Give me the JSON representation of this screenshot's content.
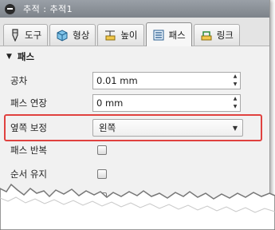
{
  "window": {
    "title": "추적 : 추적1"
  },
  "tabs": [
    {
      "label": "도구",
      "icon": "tool-icon"
    },
    {
      "label": "형상",
      "icon": "geometry-icon"
    },
    {
      "label": "높이",
      "icon": "height-icon"
    },
    {
      "label": "패스",
      "icon": "passes-icon",
      "active": true
    },
    {
      "label": "링크",
      "icon": "linking-icon"
    }
  ],
  "section": {
    "title": "패스",
    "expanded": true
  },
  "fields": {
    "tolerance": {
      "label": "공차",
      "value": "0.01 mm"
    },
    "pass_extension": {
      "label": "패스 연장",
      "value": "0 mm"
    },
    "sideways_compensation": {
      "label": "옆쪽 보정",
      "value": "왼쪽"
    },
    "reverse_passes": {
      "label": "패스 반복",
      "checked": false
    },
    "maintain_order": {
      "label": "순서 유지",
      "checked": false
    }
  },
  "colors": {
    "highlight": "#e0413f",
    "titlebar": "#8a9097"
  }
}
